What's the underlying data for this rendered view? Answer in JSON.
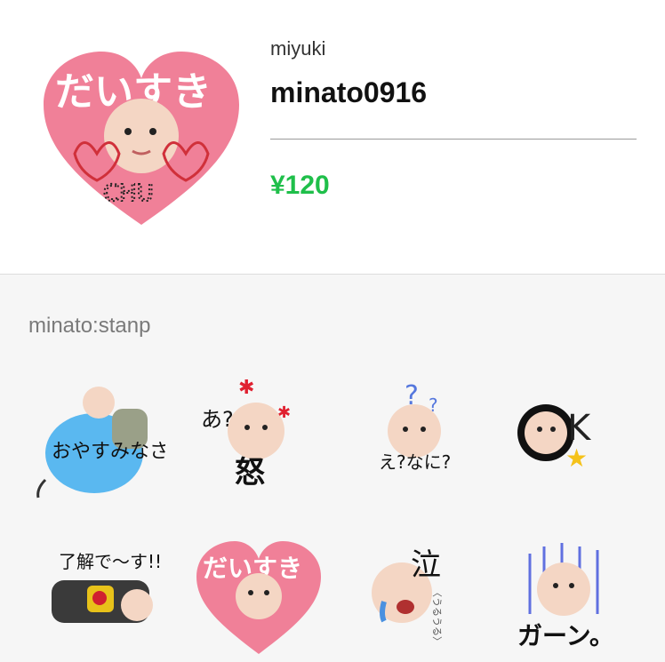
{
  "product": {
    "author": "miyuki",
    "title": "minato0916",
    "price": "¥120"
  },
  "section": {
    "title": "minato:stanp"
  },
  "stickers": [
    {
      "name": "oyasumi",
      "caption": "おやすみなさい",
      "icon": "sleeping-baby-balloon"
    },
    {
      "name": "angry",
      "caption": "怒",
      "extra": "あ?",
      "icon": "angry-baby"
    },
    {
      "name": "what",
      "caption": "え?なに?",
      "icon": "question-baby"
    },
    {
      "name": "ok",
      "caption": "OK",
      "icon": "ok-baby"
    },
    {
      "name": "understood",
      "caption": "了解で〜す!!",
      "icon": "playing-baby"
    },
    {
      "name": "love",
      "caption": "だいすき",
      "icon": "heart-baby"
    },
    {
      "name": "cry",
      "caption": "泣",
      "extra": "〈うるうる〉",
      "icon": "crying-baby"
    },
    {
      "name": "shock",
      "caption": "ガーン。",
      "icon": "shocked-baby"
    }
  ],
  "hero": {
    "caption": "だいすき",
    "sub": "CHU",
    "icon": "heart-baby"
  },
  "colors": {
    "price": "#1fbf4a",
    "heart": "#f08098",
    "balloon": "#5ab8f0"
  }
}
